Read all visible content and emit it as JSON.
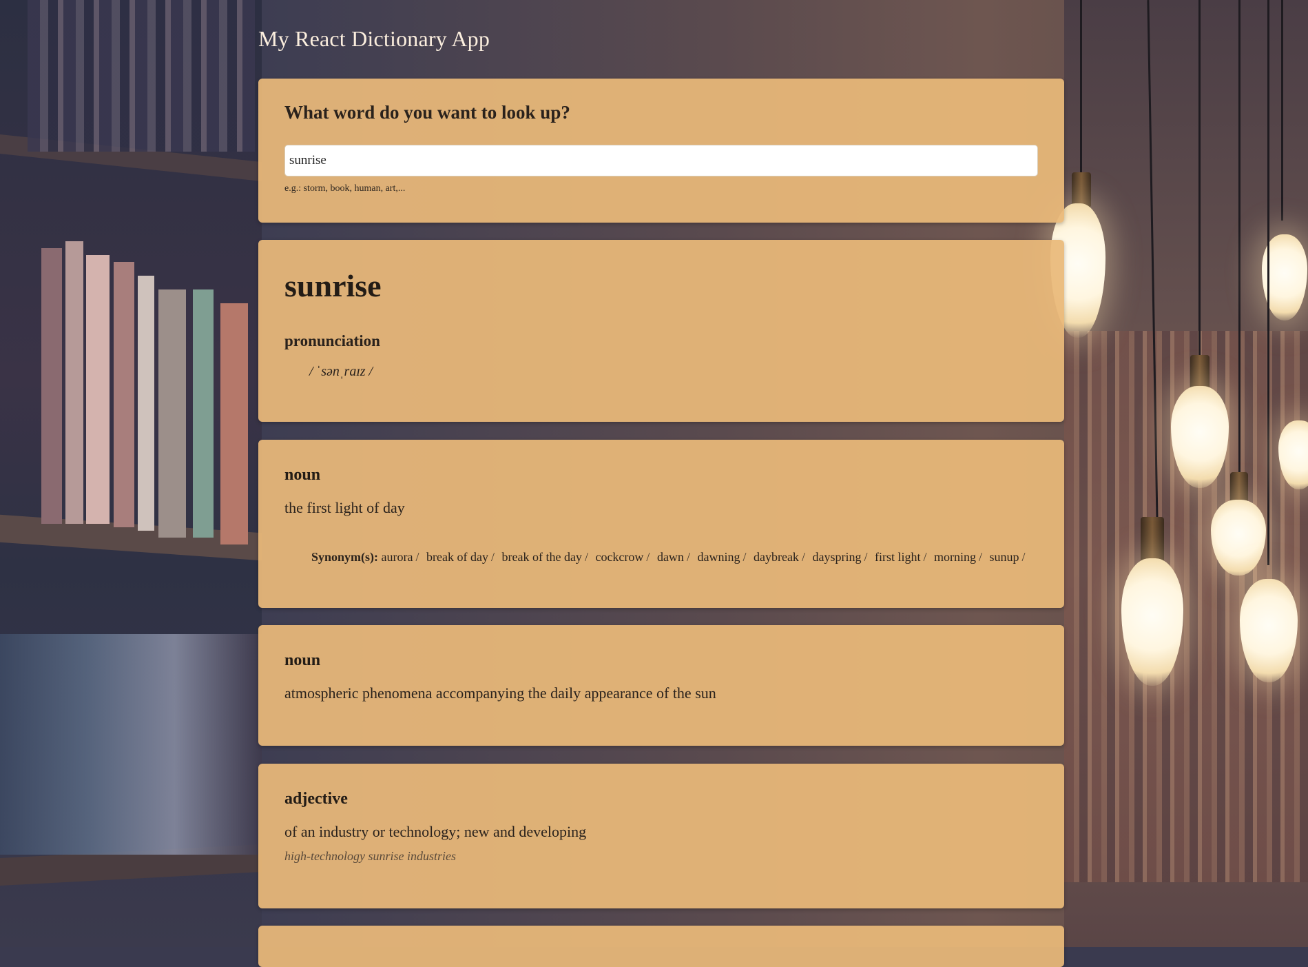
{
  "app": {
    "title": "My React Dictionary App"
  },
  "search": {
    "heading": "What word do you want to look up?",
    "value": "sunrise",
    "hint": "e.g.: storm, book, human, art,..."
  },
  "word": {
    "text": "sunrise",
    "pronunciation_label": "pronunciation",
    "phonetic": "/ ˈsənˌraɪz /"
  },
  "meanings": [
    {
      "part_of_speech": "noun",
      "definition": "the first light of day",
      "synonyms_label": "Synonym(s):",
      "synonyms": [
        "aurora",
        "break of day",
        "break of the day",
        "cockcrow",
        "dawn",
        "dawning",
        "daybreak",
        "dayspring",
        "first light",
        "morning",
        "sunup"
      ]
    },
    {
      "part_of_speech": "noun",
      "definition": "atmospheric phenomena accompanying the daily appearance of the sun"
    },
    {
      "part_of_speech": "adjective",
      "definition": "of an industry or technology; new and developing",
      "example": "high-technology sunrise industries"
    }
  ],
  "colors": {
    "card": "#eab97a",
    "title": "#fbeede",
    "text": "#2a221c"
  }
}
